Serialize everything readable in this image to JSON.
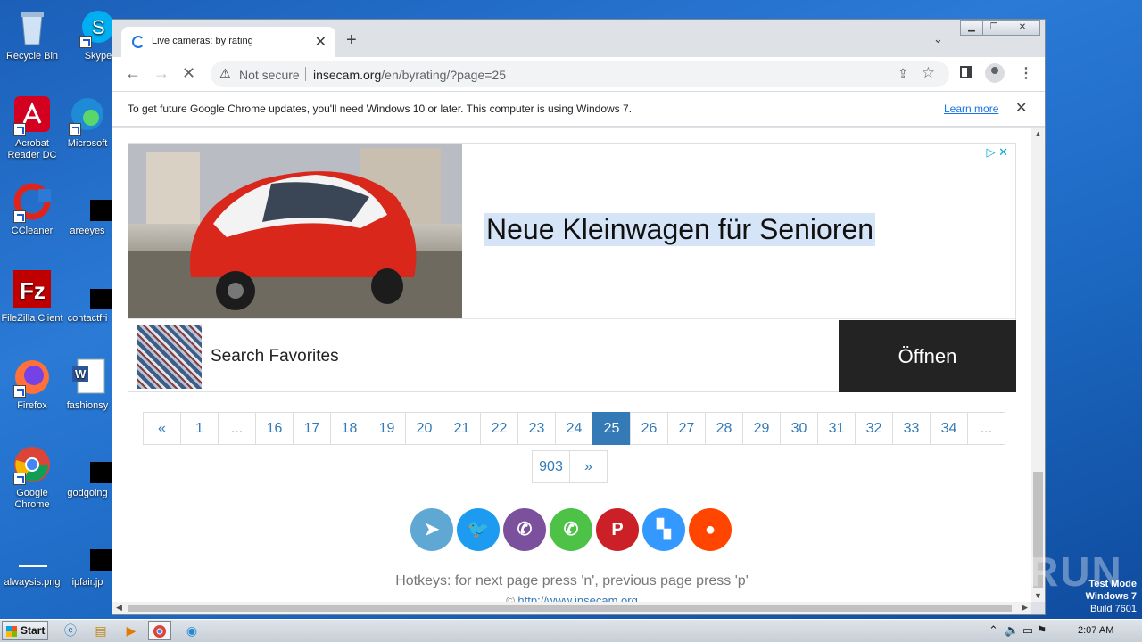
{
  "desktop": {
    "icons": [
      {
        "label": "Recycle Bin"
      },
      {
        "label": "Skype"
      },
      {
        "label": "Acrobat Reader DC"
      },
      {
        "label": "Microsoft"
      },
      {
        "label": "CCleaner"
      },
      {
        "label": "areeyes"
      },
      {
        "label": "FileZilla Client"
      },
      {
        "label": "contactfri"
      },
      {
        "label": "Firefox"
      },
      {
        "label": "fashionsy"
      },
      {
        "label": "Google Chrome"
      },
      {
        "label": "godgoing"
      },
      {
        "label": "alwaysis.png"
      },
      {
        "label": "ipfair.jp"
      }
    ],
    "watermark": "ANY RUN",
    "test_mode": {
      "line1": "Test Mode",
      "line2": "Windows 7",
      "line3": "Build 7601"
    }
  },
  "browser": {
    "tab_title": "Live cameras: by rating",
    "address": {
      "security_label": "Not secure",
      "host": "insecam.org",
      "path": "/en/byrating/?page=25"
    },
    "infobar": {
      "message": "To get future Google Chrome updates, you'll need Windows 10 or later. This computer is using Windows 7.",
      "link": "Learn more"
    }
  },
  "ad": {
    "headline": "Neue Kleinwagen für Senioren",
    "search_label": "Search Favorites",
    "button_label": "Öffnen"
  },
  "pagination": {
    "row1": [
      "«",
      "1",
      "...",
      "16",
      "17",
      "18",
      "19",
      "20",
      "21",
      "22",
      "23",
      "24",
      "25",
      "26",
      "27",
      "28",
      "29",
      "30",
      "31",
      "32",
      "33",
      "34",
      "..."
    ],
    "row2": [
      "903",
      "»"
    ],
    "active": "25"
  },
  "social": [
    {
      "name": "telegram",
      "color": "#5fa8d3",
      "glyph": "➤"
    },
    {
      "name": "twitter",
      "color": "#1d9bf0",
      "glyph": "🐦"
    },
    {
      "name": "viber",
      "color": "#7b519d",
      "glyph": "✆"
    },
    {
      "name": "whatsapp",
      "color": "#4dc247",
      "glyph": "✆"
    },
    {
      "name": "pinterest",
      "color": "#cb2027",
      "glyph": "P"
    },
    {
      "name": "delicious",
      "color": "#3399ff",
      "glyph": "▚"
    },
    {
      "name": "reddit",
      "color": "#ff4500",
      "glyph": "●"
    }
  ],
  "footer": {
    "hotkeys": "Hotkeys: for next page press 'n', previous page press 'p'",
    "copyright_link": "http://www.insecam.org"
  },
  "taskbar": {
    "start_label": "Start",
    "clock": "2:07 AM"
  }
}
